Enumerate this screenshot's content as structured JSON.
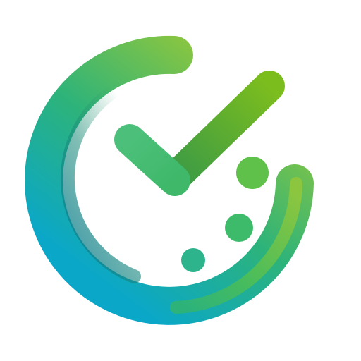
{
  "logo": {
    "icon_name": "checkmark-clock-icon",
    "colors": {
      "ring_start": "#8cc63f",
      "ring_mid": "#2db37a",
      "ring_end": "#0aa7c9",
      "ring_shade": "#1a8a78",
      "check_light": "#4cc07a",
      "check_dark": "#3a9a46",
      "check_accent": "#7cbd1e",
      "dot_large": "#5fc04a",
      "dot_mid": "#3dbb6a",
      "dot_small": "#2db48c"
    }
  }
}
